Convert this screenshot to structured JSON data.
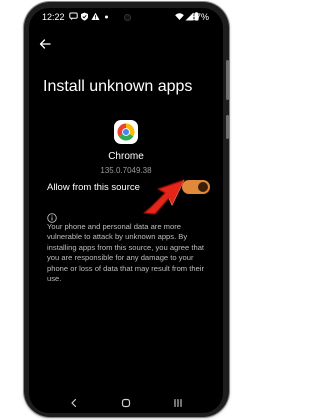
{
  "status_bar": {
    "time": "12:22",
    "battery": "87%",
    "icons": [
      "chat-bubble-icon",
      "shield-check-icon",
      "warning-triangle-icon",
      "dot-icon",
      "wifi-icon",
      "signal-icon",
      "battery-icon"
    ]
  },
  "page": {
    "title": "Install unknown apps"
  },
  "app": {
    "name": "Chrome",
    "version": "135.0.7049.38",
    "icon": "chrome-icon"
  },
  "toggle": {
    "label": "Allow from this source",
    "enabled": true,
    "accent_color": "#e0893a"
  },
  "warning": {
    "icon": "info-icon",
    "text": "Your phone and personal data are more vulnerable to attack by unknown apps. By installing apps from this source, you agree that you are responsible for any damage to your phone or loss of data that may result from their use."
  },
  "annotation": {
    "arrow_color": "#e32619"
  },
  "nav_bar": {
    "icons": [
      "back-icon",
      "home-icon",
      "recents-icon"
    ]
  }
}
